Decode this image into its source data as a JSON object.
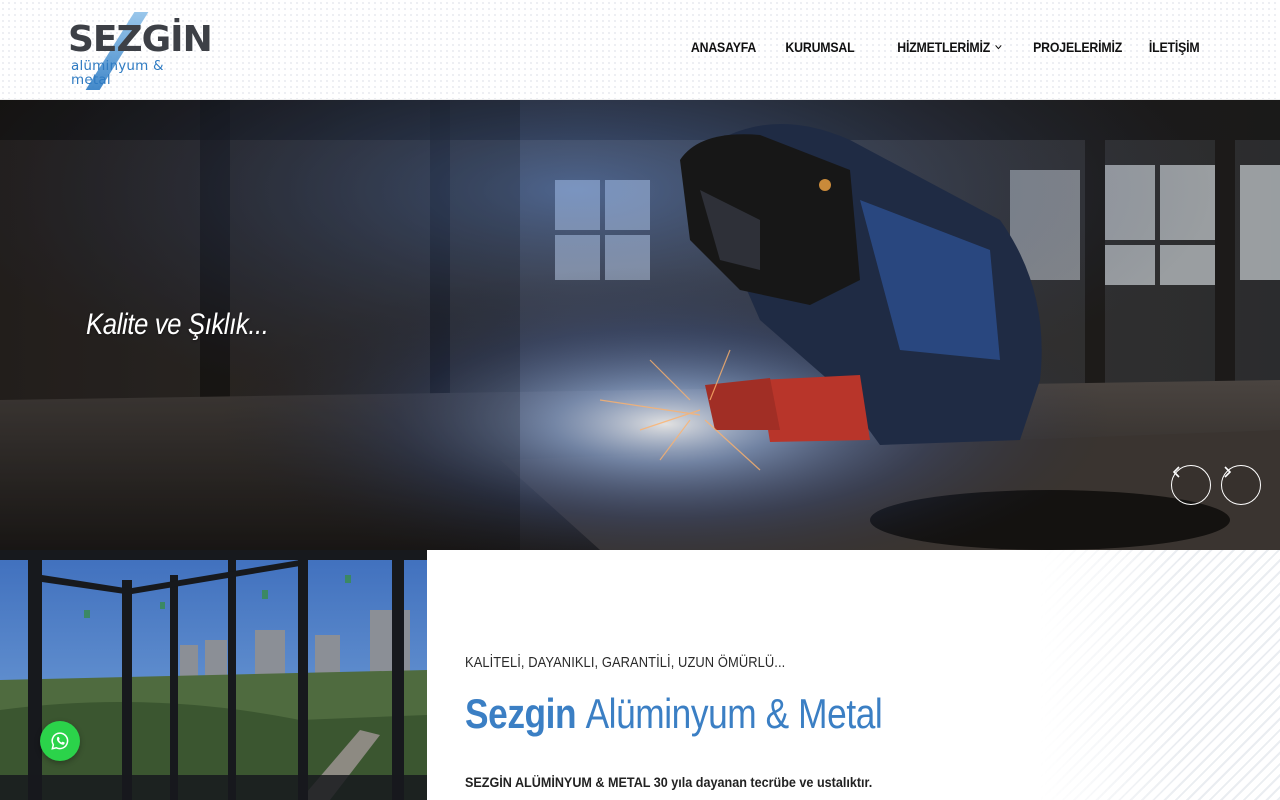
{
  "brand": {
    "name": "SEZGİN",
    "tagline": "alüminyum & metal"
  },
  "nav": {
    "items": [
      {
        "label": "ANASAYFA"
      },
      {
        "label": "KURUMSAL"
      },
      {
        "label": "HİZMETLERİMİZ",
        "has_dropdown": true
      },
      {
        "label": "PROJELERİMİZ"
      },
      {
        "label": "İLETİŞİM"
      }
    ]
  },
  "hero": {
    "caption": "Kalite ve Şıklık...",
    "prev_icon": "chevron-left-icon",
    "next_icon": "chevron-right-icon"
  },
  "about": {
    "kicker": "KALİTELİ, DAYANIKLI, GARANTİLİ, UZUN ÖMÜRLÜ...",
    "title_strong": "Sezgin",
    "title_light": "Alüminyum & Metal",
    "text": "SEZGİN ALÜMİNYUM & METAL 30 yıla dayanan tecrübe ve ustalıktır."
  },
  "floating": {
    "whatsapp_icon": "whatsapp-icon"
  },
  "colors": {
    "accent": "#3b7fc4",
    "whatsapp": "#2bd34a"
  }
}
